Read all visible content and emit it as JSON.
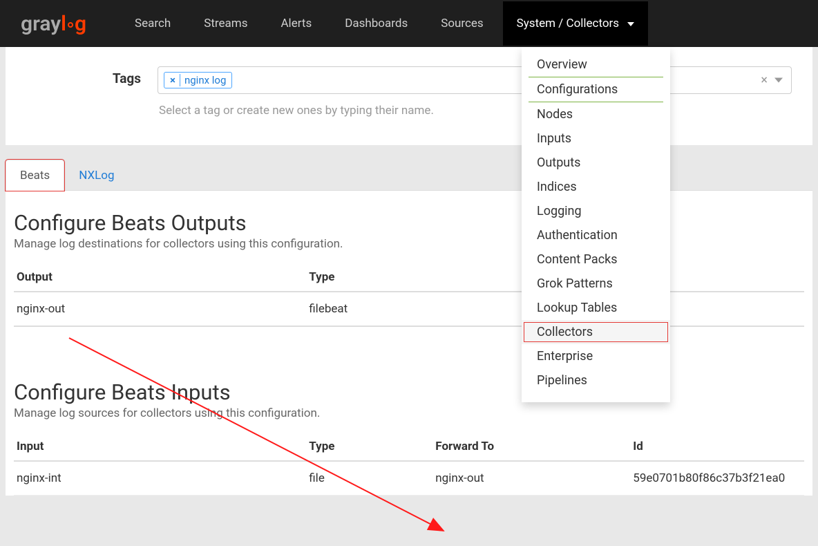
{
  "logo": {
    "part1": "gray",
    "part2": "l",
    "part3": "g"
  },
  "nav": {
    "items": [
      {
        "label": "Search"
      },
      {
        "label": "Streams"
      },
      {
        "label": "Alerts"
      },
      {
        "label": "Dashboards"
      },
      {
        "label": "Sources"
      }
    ],
    "system_label": "System / Collectors"
  },
  "dropdown": {
    "overview": "Overview",
    "configurations": "Configurations",
    "nodes": "Nodes",
    "inputs": "Inputs",
    "outputs": "Outputs",
    "indices": "Indices",
    "logging": "Logging",
    "authentication": "Authentication",
    "content_packs": "Content Packs",
    "grok_patterns": "Grok Patterns",
    "lookup_tables": "Lookup Tables",
    "collectors": "Collectors",
    "enterprise": "Enterprise",
    "pipelines": "Pipelines"
  },
  "tags": {
    "label": "Tags",
    "chip": "nginx log",
    "help": "Select a tag or create new ones by typing their name."
  },
  "tabs": {
    "beats": "Beats",
    "nxlog": "NXLog"
  },
  "outputs": {
    "title": "Configure Beats Outputs",
    "sub": "Manage log destinations for collectors using this configuration.",
    "headers": {
      "output": "Output",
      "type": "Type"
    },
    "rows": [
      {
        "output": "nginx-out",
        "type": "filebeat"
      }
    ]
  },
  "inputs": {
    "title": "Configure Beats Inputs",
    "sub": "Manage log sources for collectors using this configuration.",
    "headers": {
      "input": "Input",
      "type": "Type",
      "forward": "Forward To",
      "id": "Id"
    },
    "rows": [
      {
        "input": "nginx-int",
        "type": "file",
        "forward": "nginx-out",
        "id": "59e0701b80f86c37b3f21ea0"
      }
    ]
  }
}
